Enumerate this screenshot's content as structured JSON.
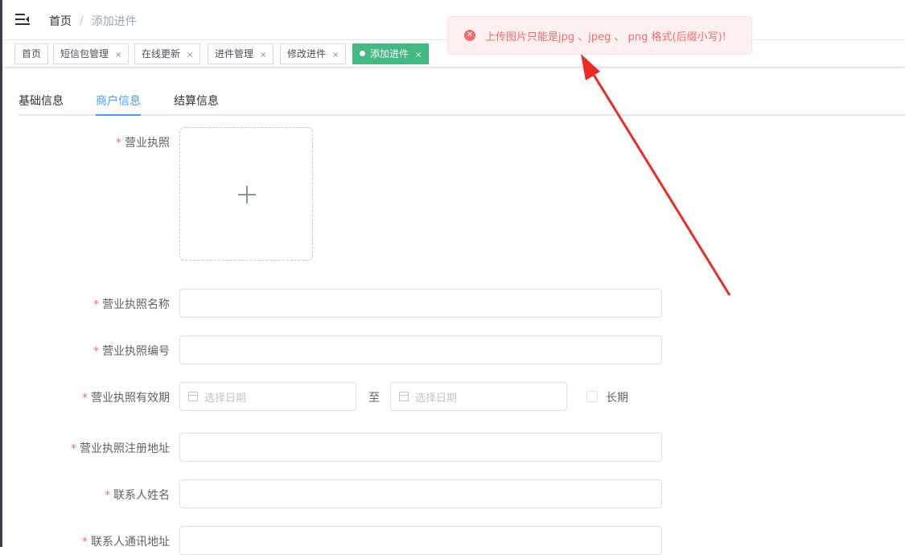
{
  "breadcrumb": {
    "home": "首页",
    "separator": "/",
    "current": "添加进件"
  },
  "tags": [
    {
      "label": "首页",
      "closable": false,
      "active": false
    },
    {
      "label": "短信包管理",
      "closable": true,
      "active": false
    },
    {
      "label": "在线更新",
      "closable": true,
      "active": false
    },
    {
      "label": "进件管理",
      "closable": true,
      "active": false
    },
    {
      "label": "修改进件",
      "closable": true,
      "active": false
    },
    {
      "label": "添加进件",
      "closable": true,
      "active": true
    }
  ],
  "tag_close_glyph": "×",
  "toast": {
    "icon": "error-circle-icon",
    "icon_glyph": "✕",
    "message": "上传图片只能是jpg 、jpeg 、 png 格式(后缀小写)!"
  },
  "tabs": [
    {
      "label": "基础信息",
      "active": false
    },
    {
      "label": "商户信息",
      "active": true
    },
    {
      "label": "结算信息",
      "active": false
    }
  ],
  "form": {
    "required_mark": "*",
    "license_image_label": "营业执照",
    "license_name_label": "营业执照名称",
    "license_name_value": "",
    "license_number_label": "营业执照编号",
    "license_number_value": "",
    "license_validity_label": "营业执照有效期",
    "date_start_placeholder": "选择日期",
    "date_to": "至",
    "date_end_placeholder": "选择日期",
    "long_term_label": "长期",
    "long_term_checked": false,
    "license_address_label": "营业执照注册地址",
    "license_address_value": "",
    "contact_name_label": "联系人姓名",
    "contact_name_value": "",
    "contact_address_label": "联系人通讯地址",
    "contact_address_value": ""
  },
  "colors": {
    "accent": "#409eff",
    "active_tag": "#42b983",
    "error": "#f56c6c",
    "arrow": "#ee2a24"
  }
}
